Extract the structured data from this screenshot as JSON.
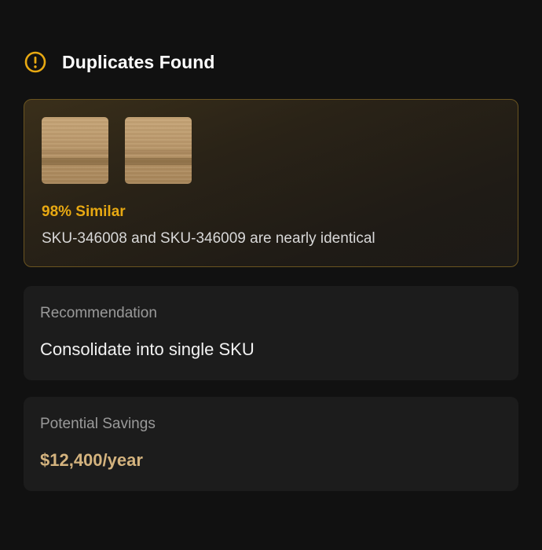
{
  "header": {
    "title": "Duplicates Found",
    "icon": "warning-circle-icon",
    "icon_color": "#e8a912"
  },
  "duplicate": {
    "similarity": "98% Similar",
    "description": "SKU-346008 and SKU-346009 are nearly identical",
    "thumbnails": [
      "wood-swatch-1",
      "wood-swatch-2"
    ],
    "accent_color": "#e8a912",
    "border_color": "#6a5420"
  },
  "recommendation": {
    "label": "Recommendation",
    "value": "Consolidate into single SKU"
  },
  "savings": {
    "label": "Potential Savings",
    "value": "$12,400/year",
    "value_color": "#d4b37e"
  }
}
